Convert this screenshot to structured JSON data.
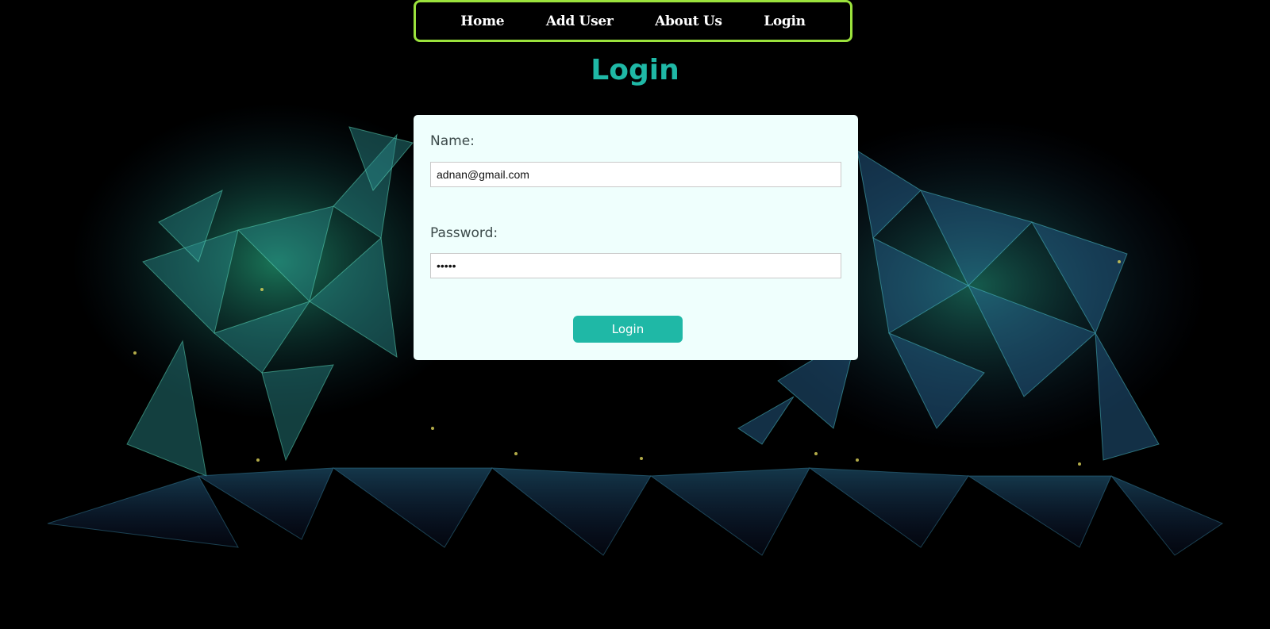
{
  "nav": {
    "items": [
      {
        "label": "Home"
      },
      {
        "label": "Add User"
      },
      {
        "label": "About Us"
      },
      {
        "label": "Login"
      }
    ],
    "border_color": "#9be23c"
  },
  "page": {
    "title": "Login",
    "accent_color": "#1fb8a6",
    "background_image": "polygon-bull-and-bear"
  },
  "form": {
    "name_label": "Name:",
    "name_value": "adnan@gmail.com",
    "password_label": "Password:",
    "password_value": "•••••",
    "submit_label": "Login"
  }
}
